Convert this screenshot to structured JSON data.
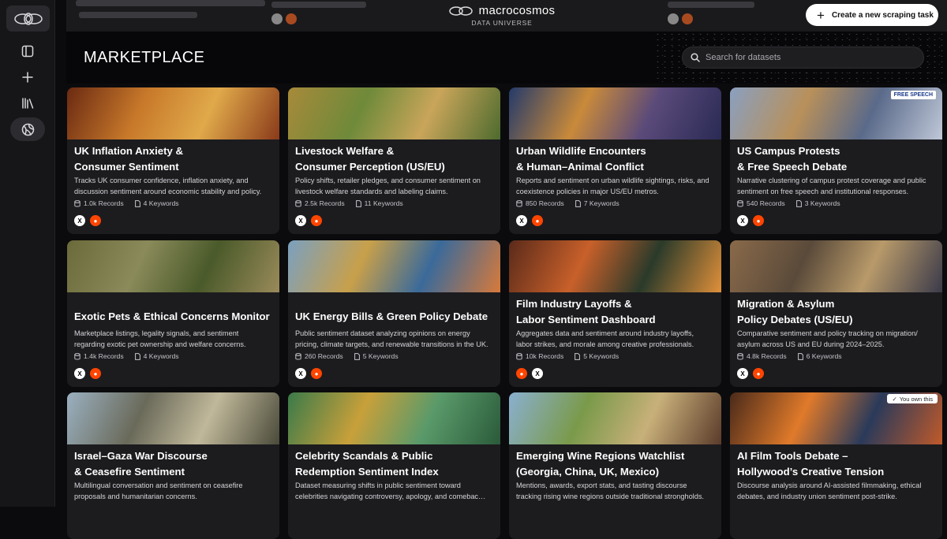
{
  "brand": {
    "name": "macrocosmos",
    "sub": "DATA UNIVERSE"
  },
  "header": {
    "create_label": "Create a new scraping task"
  },
  "hero": {
    "title": "MARKETPLACE",
    "search_placeholder": "Search for datasets"
  },
  "sidebar": {
    "items": [
      {
        "icon": "panel-icon"
      },
      {
        "icon": "plus-icon"
      },
      {
        "icon": "library-icon"
      },
      {
        "icon": "globe-icon",
        "active": true
      }
    ]
  },
  "cards": [
    {
      "title1": "UK Inflation Anxiety &",
      "title2": "Consumer Sentiment",
      "desc1": "Tracks UK consumer confidence, inflation anxiety, and",
      "desc2": "discussion sentiment around economic stability and policy.",
      "records": "1.0k Records",
      "keywords": "4 Keywords",
      "sources": [
        "x",
        "reddit"
      ],
      "colors": [
        "#6b2a12",
        "#c8792a",
        "#e0a94a",
        "#8a3a1a"
      ]
    },
    {
      "title1": "Livestock Welfare &",
      "title2": "Consumer Perception (US/EU)",
      "desc1": "Policy shifts, retailer pledges, and consumer sentiment on",
      "desc2": "livestock welfare standards and labeling claims.",
      "records": "2.5k Records",
      "keywords": "11 Keywords",
      "sources": [
        "x",
        "reddit"
      ],
      "colors": [
        "#a78a3a",
        "#6e8a3a",
        "#c9a55a",
        "#4d6b2e"
      ]
    },
    {
      "title1": "Urban Wildlife Encounters",
      "title2": "& Human–Animal Conflict",
      "desc1": "Reports and sentiment on urban wildlife sightings, risks, and",
      "desc2": "coexistence policies in major US/EU metros.",
      "records": "850 Records",
      "keywords": "7 Keywords",
      "sources": [
        "x",
        "reddit"
      ],
      "colors": [
        "#243a6a",
        "#c98a3a",
        "#5a4a7a",
        "#2a2a55"
      ]
    },
    {
      "title1": "US Campus Protests",
      "title2": "& Free Speech Debate",
      "desc1": "Narrative clustering of campus protest coverage and public",
      "desc2": "sentiment on free speech and institutional responses.",
      "records": "540 Records",
      "keywords": "3 Keywords",
      "sources": [
        "x",
        "reddit"
      ],
      "colors": [
        "#8aa0c0",
        "#b8905a",
        "#5a6a8a",
        "#c0c8d8"
      ],
      "badge": "FREE SPEECH"
    },
    {
      "title1": "Exotic Pets & Ethical Concerns Monitor",
      "title2": "",
      "desc1": "Marketplace listings, legality signals, and sentiment",
      "desc2": "regarding exotic pet ownership and welfare concerns.",
      "records": "1.4k Records",
      "keywords": "4 Keywords",
      "sources": [
        "x",
        "reddit"
      ],
      "colors": [
        "#6a6a3a",
        "#8a8a5a",
        "#4a5a2a",
        "#9a8a5a"
      ]
    },
    {
      "title1": "UK Energy Bills & Green Policy Debate",
      "title2": "",
      "desc1": "Public sentiment dataset analyzing opinions on energy",
      "desc2": "pricing, climate targets, and renewable transitions in the UK.",
      "records": "260 Records",
      "keywords": "5 Keywords",
      "sources": [
        "x",
        "reddit"
      ],
      "colors": [
        "#7aa0c0",
        "#c8a04a",
        "#3a6a9a",
        "#d87a3a"
      ]
    },
    {
      "title1": "Film Industry Layoffs &",
      "title2": "Labor Sentiment Dashboard",
      "desc1": "Aggregates data and sentiment around industry layoffs,",
      "desc2": "labor strikes, and morale among creative professionals.",
      "records": "10k Records",
      "keywords": "5 Keywords",
      "sources": [
        "reddit",
        "x"
      ],
      "colors": [
        "#5a2a1a",
        "#c8602a",
        "#2a3a2a",
        "#e0903a"
      ]
    },
    {
      "title1": "Migration & Asylum",
      "title2": "Policy Debates (US/EU)",
      "desc1": "Comparative sentiment and policy tracking on migration/",
      "desc2": "asylum across US and EU during 2024–2025.",
      "records": "4.8k Records",
      "keywords": "6 Keywords",
      "sources": [
        "x",
        "reddit"
      ],
      "colors": [
        "#8a6a4a",
        "#5a4a3a",
        "#b89a6a",
        "#3a3a4a"
      ]
    },
    {
      "title1": "Israel–Gaza War Discourse",
      "title2": "& Ceasefire Sentiment",
      "desc1": "Multilingual conversation and sentiment on ceasefire",
      "desc2": "proposals and humanitarian concerns.",
      "records": "",
      "keywords": "",
      "sources": [],
      "colors": [
        "#9ab0c0",
        "#6a6a5a",
        "#c0b89a",
        "#4a4a3a"
      ]
    },
    {
      "title1": "Celebrity Scandals & Public",
      "title2": "Redemption Sentiment Index",
      "desc1": "Dataset measuring shifts in public sentiment toward",
      "desc2": "celebrities navigating controversy, apology, and comebac…",
      "records": "",
      "keywords": "",
      "sources": [],
      "colors": [
        "#3a7a4a",
        "#c8a03a",
        "#5a9a6a",
        "#2a5a3a"
      ]
    },
    {
      "title1": "Emerging Wine Regions Watchlist",
      "title2": "(Georgia, China, UK, Mexico)",
      "desc1": "Mentions, awards, export stats, and tasting discourse",
      "desc2": "tracking rising wine regions outside traditional strongholds.",
      "records": "",
      "keywords": "",
      "sources": [],
      "colors": [
        "#8ab0d0",
        "#7a9a4a",
        "#c8b07a",
        "#5a3a2a"
      ]
    },
    {
      "title1": "AI Film Tools Debate –",
      "title2": "Hollywood’s Creative Tension",
      "desc1": "Discourse analysis around AI-assisted filmmaking, ethical",
      "desc2": "debates, and industry union sentiment post-strike.",
      "records": "",
      "keywords": "",
      "sources": [],
      "colors": [
        "#4a2a1a",
        "#e07a2a",
        "#2a3a5a",
        "#c05a2a"
      ],
      "owned": "You own this"
    }
  ]
}
